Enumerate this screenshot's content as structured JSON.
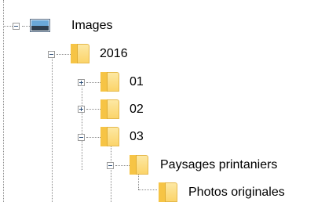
{
  "tree": {
    "root": {
      "label": "Images",
      "icon": "images-icon",
      "expanded": true
    },
    "year": {
      "label": "2016",
      "icon": "folder-icon",
      "expanded": true
    },
    "months": [
      {
        "label": "01",
        "icon": "folder-icon",
        "expanded": false
      },
      {
        "label": "02",
        "icon": "folder-icon",
        "expanded": false
      },
      {
        "label": "03",
        "icon": "folder-icon",
        "expanded": true
      }
    ],
    "subfolder": {
      "label": "Paysages printaniers",
      "icon": "folder-icon",
      "expanded": true
    },
    "leaf": {
      "label": "Photos originales",
      "icon": "folder-icon"
    }
  },
  "colors": {
    "folder_fill": "#fbd46a",
    "folder_tab": "#f6c445",
    "connector": "#8a8a8a",
    "expander_glyph": "#2d4f7a"
  }
}
